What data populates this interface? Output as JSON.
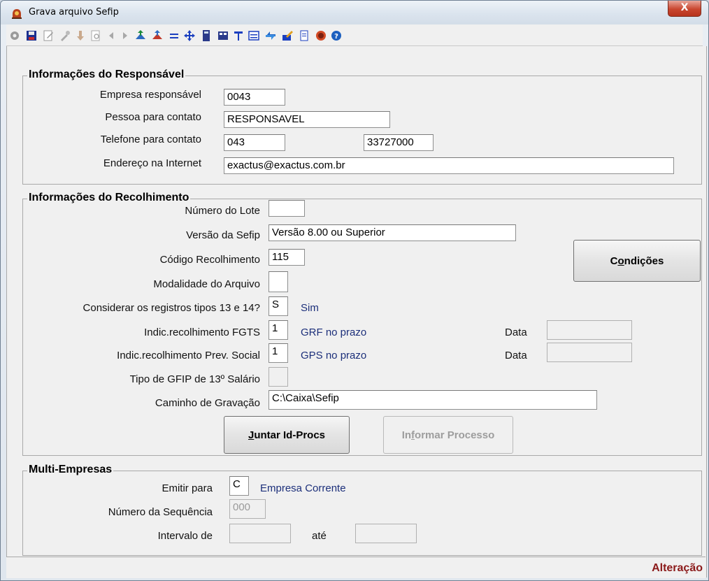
{
  "window": {
    "title": "Grava arquivo Sefip",
    "close_label": "X"
  },
  "toolbar": {
    "icons": [
      "gear-icon",
      "save-icon",
      "edit-icon",
      "tools-icon",
      "down-icon",
      "preview-icon",
      "prev-icon",
      "next-icon",
      "import-icon",
      "export-icon",
      "equals-icon",
      "move-icon",
      "calc-icon",
      "form-icon",
      "filter-icon",
      "report-icon",
      "transfer-icon",
      "write-icon",
      "doc-icon",
      "exit-icon",
      "help-icon"
    ]
  },
  "responsavel": {
    "title": "Informações do Responsável",
    "empresa_label": "Empresa responsável",
    "empresa_value": "0043",
    "pessoa_label": "Pessoa para contato",
    "pessoa_value": "RESPONSAVEL",
    "telefone_label": "Telefone para contato",
    "ddd_value": "043",
    "telefone_value": "33727000",
    "email_label": "Endereço na Internet",
    "email_value": "exactus@exactus.com.br"
  },
  "recolhimento": {
    "title": "Informações do Recolhimento",
    "lote_label": "Número do Lote",
    "lote_value": "",
    "versao_label": "Versão da Sefip",
    "versao_value": "Versão 8.00 ou Superior",
    "codigo_label": "Código Recolhimento",
    "codigo_value": "115",
    "modalidade_label": "Modalidade do Arquivo",
    "modalidade_value": "",
    "considerar_label": "Considerar os registros tipos 13 e 14?",
    "considerar_value": "S",
    "considerar_desc": "Sim",
    "fgts_label": "Indic.recolhimento FGTS",
    "fgts_value": "1",
    "fgts_desc": "GRF no prazo",
    "prev_label": "Indic.recolhimento Prev. Social",
    "prev_value": "1",
    "prev_desc": "GPS no prazo",
    "data_label": "Data",
    "data_fgts": "",
    "data_prev": "",
    "gfip_label": "Tipo de GFIP de 13º Salário",
    "gfip_value": "",
    "caminho_label": "Caminho de Gravação",
    "caminho_value": "C:\\Caixa\\Sefip",
    "condicoes_pre": "C",
    "condicoes_ul": "o",
    "condicoes_post": "ndições",
    "juntar_pre": "",
    "juntar_ul": "J",
    "juntar_post": "untar Id-Procs",
    "informar_pre": "In",
    "informar_ul": "f",
    "informar_post": "ormar Processo"
  },
  "multi": {
    "title": "Multi-Empresas",
    "emitir_label": "Emitir para",
    "emitir_value": "C",
    "emitir_desc": "Empresa Corrente",
    "sequencia_label": "Número da Sequência",
    "sequencia_value": "000",
    "intervalo_label": "Intervalo de",
    "intervalo_de": "",
    "ate_label": "até",
    "intervalo_ate": ""
  },
  "status": {
    "text": "Alteração"
  }
}
